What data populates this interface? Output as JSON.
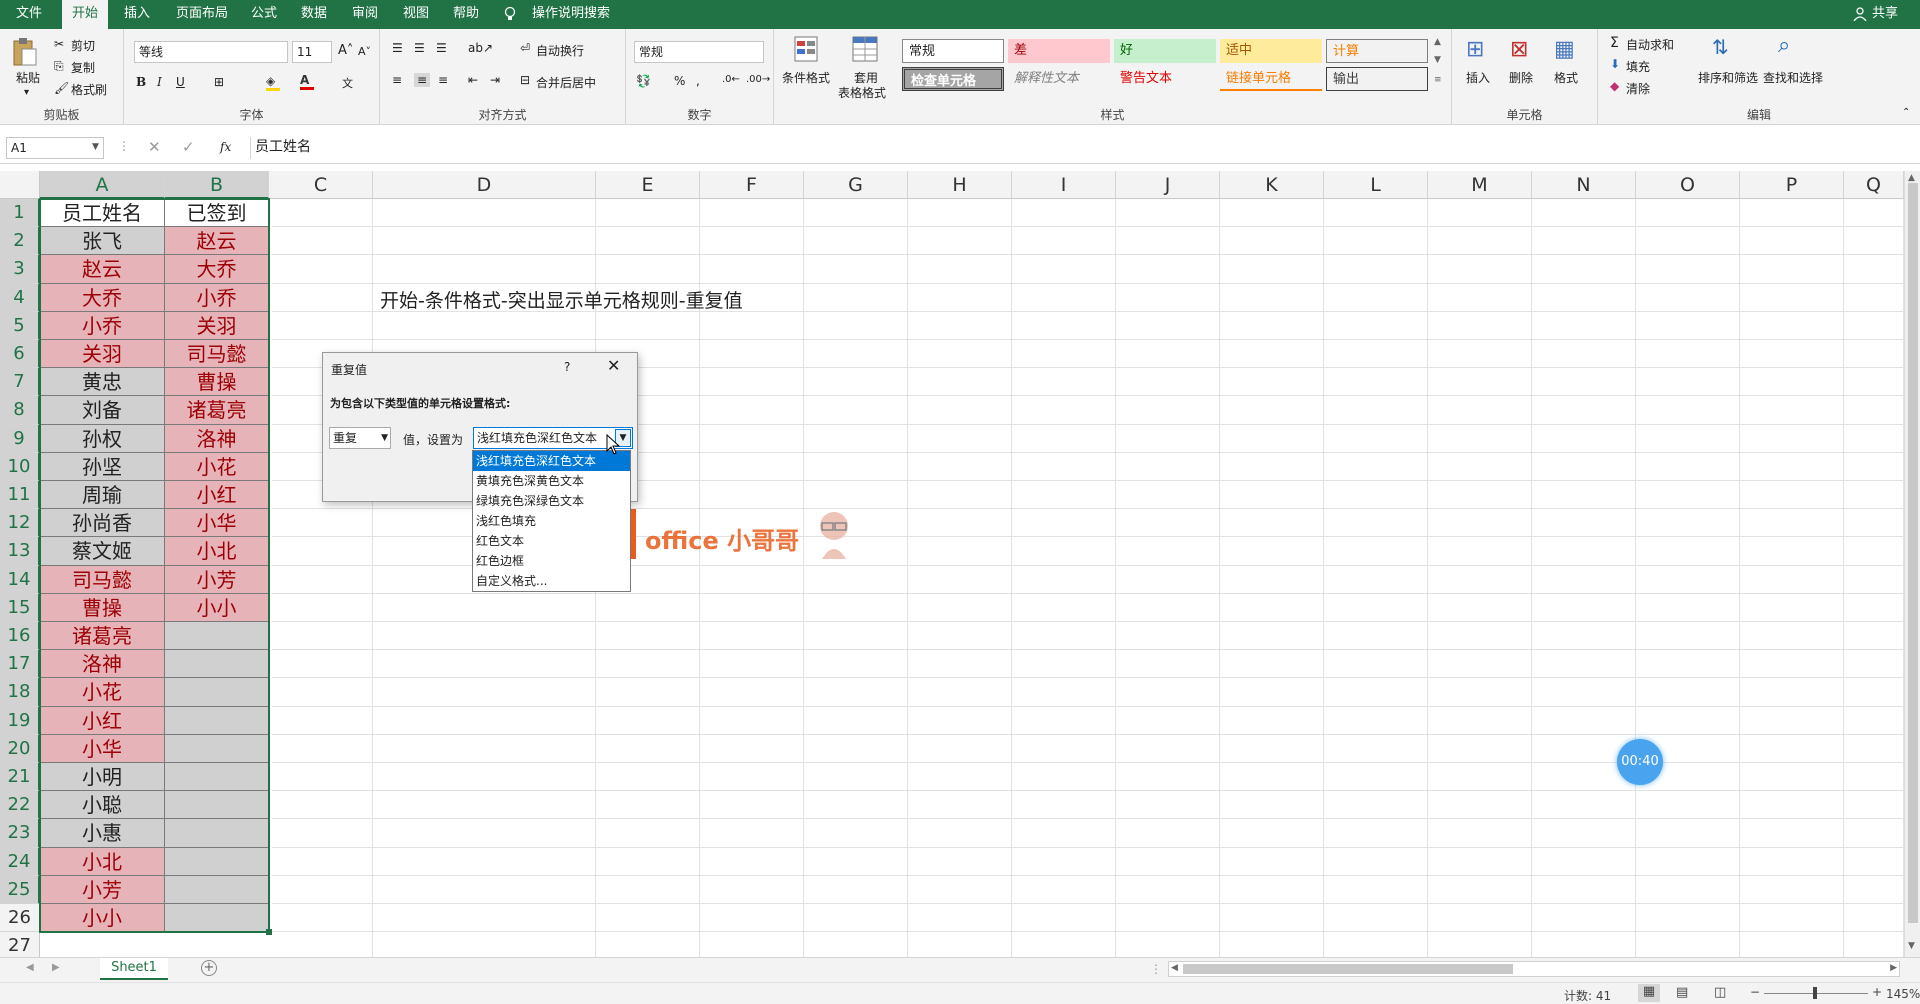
{
  "tabs": [
    "文件",
    "开始",
    "插入",
    "页面布局",
    "公式",
    "数据",
    "审阅",
    "视图",
    "帮助",
    "操作说明搜索"
  ],
  "share": "共享",
  "ribbon": {
    "clipboard": {
      "paste": "粘贴",
      "cut": "剪切",
      "copy": "复制",
      "format_painter": "格式刷",
      "label": "剪贴板"
    },
    "font": {
      "name": "等线",
      "size": "11",
      "label": "字体"
    },
    "alignment": {
      "wrap": "自动换行",
      "merge": "合并后居中",
      "label": "对齐方式"
    },
    "number": {
      "format": "常规",
      "label": "数字"
    },
    "styles": {
      "cond_format": "条件格式",
      "table_format_1": "套用",
      "table_format_2": "表格格式",
      "normal": "常规",
      "bad": "差",
      "good": "好",
      "neutral": "适中",
      "calc": "计算",
      "check": "检查单元格",
      "explanatory": "解释性文本",
      "warning": "警告文本",
      "linked": "链接单元格",
      "output": "输出",
      "label": "样式"
    },
    "cells": {
      "insert": "插入",
      "delete": "删除",
      "format": "格式",
      "label": "单元格"
    },
    "editing": {
      "autosum": "自动求和",
      "fill": "填充",
      "clear": "清除",
      "sort": "排序和筛选",
      "find": "查找和选择",
      "label": "编辑"
    }
  },
  "formula_bar": {
    "name_box": "A1",
    "fx": "fx",
    "content": "员工姓名"
  },
  "columns": [
    "A",
    "B",
    "C",
    "D",
    "E",
    "F",
    "G",
    "H",
    "I",
    "J",
    "K",
    "L",
    "M",
    "N",
    "O",
    "P",
    "Q"
  ],
  "headers": {
    "a": "员工姓名",
    "b": "已签到"
  },
  "col_a": [
    "张飞",
    "赵云",
    "大乔",
    "小乔",
    "关羽",
    "黄忠",
    "刘备",
    "孙权",
    "孙坚",
    "周瑜",
    "孙尚香",
    "蔡文姬",
    "司马懿",
    "曹操",
    "诸葛亮",
    "洛神",
    "小花",
    "小红",
    "小华",
    "小明",
    "小聪",
    "小惠",
    "小北",
    "小芳",
    "小小"
  ],
  "col_a_dup": [
    false,
    true,
    true,
    true,
    true,
    false,
    false,
    false,
    false,
    false,
    false,
    false,
    true,
    true,
    true,
    true,
    true,
    true,
    true,
    false,
    false,
    false,
    true,
    true,
    true
  ],
  "col_b": [
    "赵云",
    "大乔",
    "小乔",
    "关羽",
    "司马懿",
    "曹操",
    "诸葛亮",
    "洛神",
    "小花",
    "小红",
    "小华",
    "小北",
    "小芳",
    "小小"
  ],
  "instruction": "开始-条件格式-突出显示单元格规则-重复值",
  "dialog": {
    "title": "重复值",
    "help": "?",
    "prompt": "为包含以下类型值的单元格设置格式:",
    "type_value": "重复",
    "value_label": "值，设置为",
    "format_value": "浅红填充色深红色文本",
    "options": [
      "浅红填充色深红色文本",
      "黄填充色深黄色文本",
      "绿填充色深绿色文本",
      "浅红色填充",
      "红色文本",
      "红色边框",
      "自定义格式..."
    ]
  },
  "watermark": {
    "text": "office 小哥哥"
  },
  "timer": "00:40",
  "sheet_tab": "Sheet1",
  "status": {
    "count": "计数: 41",
    "zoom": "145%"
  },
  "colors": {
    "excel_green": "#217346",
    "dup_fill": "#e6b4b8",
    "dup_text": "#9c0006",
    "cell_fill": "#d0d0d0",
    "select": "#0078d7"
  }
}
